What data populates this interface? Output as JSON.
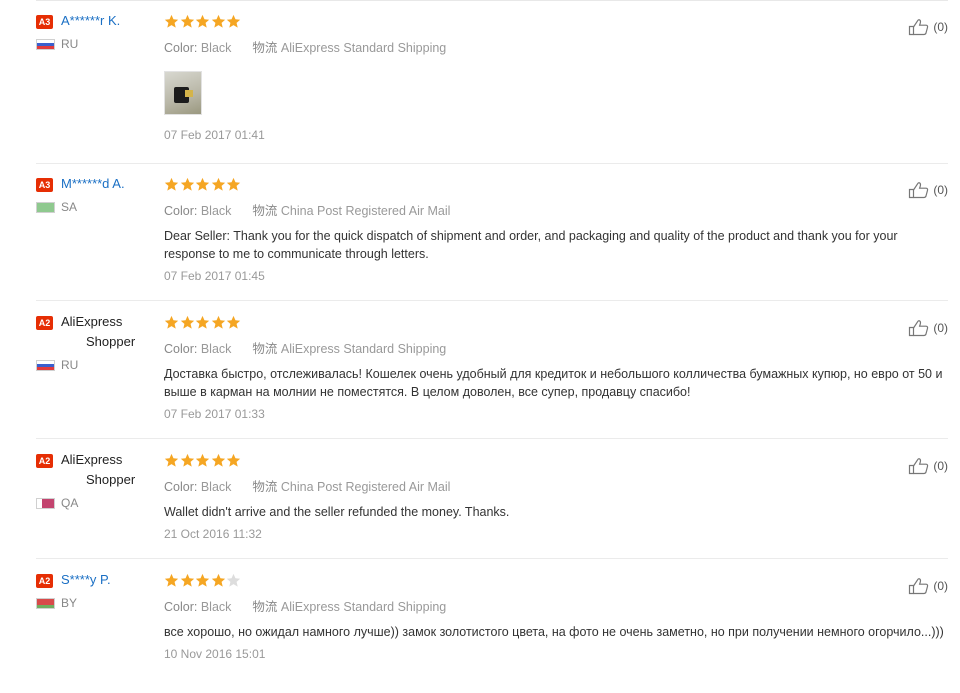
{
  "reviews": [
    {
      "level": "A3",
      "user": "A******r K.",
      "country": "RU",
      "rating": 5,
      "color_label": "Color:",
      "color_value": "Black",
      "shipping_label": "物流",
      "shipping_value": "AliExpress Standard Shipping",
      "text": "",
      "has_photo": true,
      "date": "07 Feb 2017 01:41",
      "likes": "(0)"
    },
    {
      "level": "A3",
      "user": "M******d A.",
      "country": "SA",
      "rating": 5,
      "color_label": "Color:",
      "color_value": "Black",
      "shipping_label": "物流",
      "shipping_value": "China Post Registered Air Mail",
      "text": "Dear Seller: Thank you for the quick dispatch of shipment and order, and packaging and quality of the product and thank you for your response to me to communicate through letters.",
      "has_photo": false,
      "date": "07 Feb 2017 01:45",
      "likes": "(0)"
    },
    {
      "level": "A2",
      "user": "AliExpress Shopper",
      "country": "RU",
      "rating": 5,
      "color_label": "Color:",
      "color_value": "Black",
      "shipping_label": "物流",
      "shipping_value": "AliExpress Standard Shipping",
      "text": "Доставка быстро, отслеживалась! Кошелек очень удобный для кредиток и небольшого колличества бумажных купюр, но евро от 50 и выше в карман на молнии не поместятся. В целом доволен, все супер, продавцу спасибо!",
      "has_photo": false,
      "date": "07 Feb 2017 01:33",
      "likes": "(0)"
    },
    {
      "level": "A2",
      "user": "AliExpress Shopper",
      "country": "QA",
      "rating": 5,
      "color_label": "Color:",
      "color_value": "Black",
      "shipping_label": "物流",
      "shipping_value": "China Post Registered Air Mail",
      "text": "Wallet didn't arrive and the seller refunded the money. Thanks.",
      "has_photo": false,
      "date": "21 Oct 2016 11:32",
      "likes": "(0)"
    },
    {
      "level": "A2",
      "user": "S****y P.",
      "country": "BY",
      "rating": 4,
      "color_label": "Color:",
      "color_value": "Black",
      "shipping_label": "物流",
      "shipping_value": "AliExpress Standard Shipping",
      "text": "все хорошо, но ожидал намного лучше)) замок золотистого цвета, на фото не очень заметно, но при получении немного огорчило...)))",
      "has_photo": false,
      "date": "10 Nov 2016 15:01",
      "likes": "(0)"
    }
  ],
  "colors": {
    "star_filled": "#f5a623",
    "star_empty": "#dddddd",
    "badge": "#e62e04",
    "link": "#1a6fc4"
  },
  "icons": {
    "like": "thumbs-up-icon",
    "star": "star-icon"
  }
}
